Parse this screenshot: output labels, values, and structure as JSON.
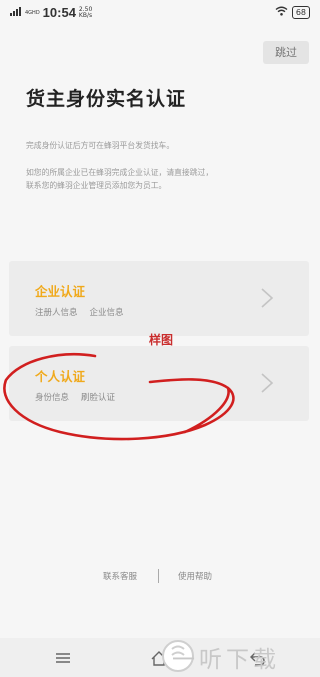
{
  "status": {
    "carrier": "4GHD",
    "time": "10:54",
    "speed_value": "2.50",
    "speed_unit": "KB/s",
    "battery": "68"
  },
  "header": {
    "skip_label": "跳过"
  },
  "main": {
    "title": "货主身份实名认证",
    "desc1": "完成身份认证后方可在蜂羽平台发货找车。",
    "desc2_line1": "如您的所属企业已在蜂羽完成企业认证，请直接跳过，",
    "desc2_line2": "联系您的蜂羽企业管理员添加您为员工。"
  },
  "cards": [
    {
      "title": "企业认证",
      "sub1": "注册人信息",
      "sub2": "企业信息"
    },
    {
      "title": "个人认证",
      "sub1": "身份信息",
      "sub2": "刷脸认证"
    }
  ],
  "annotation": {
    "sample_label": "样图",
    "color": "#c92d2d"
  },
  "footer": {
    "contact": "联系客服",
    "help": "使用帮助"
  },
  "watermark": "一听下载",
  "colors": {
    "accent": "#f0a91b",
    "card_bg": "#ececec",
    "background": "#f6f6f6"
  }
}
